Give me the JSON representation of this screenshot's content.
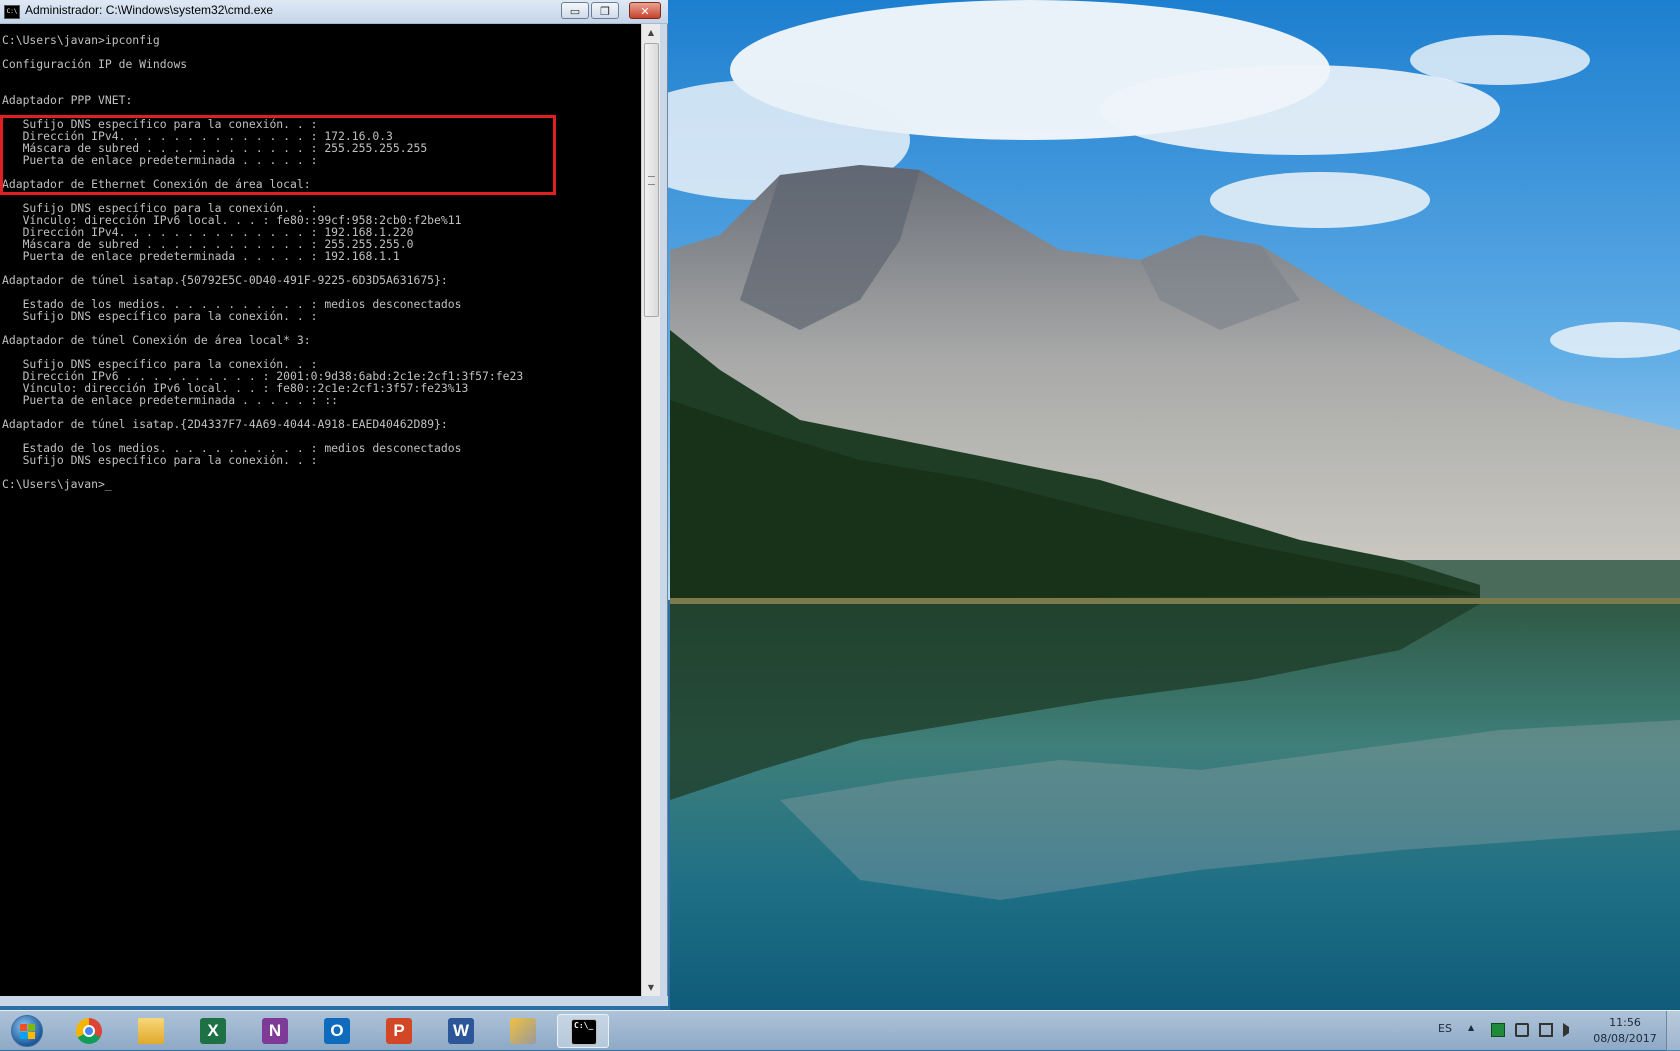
{
  "window": {
    "title": "Administrador: C:\\Windows\\system32\\cmd.exe",
    "title_icon_text": "C:\\",
    "minimize_glyph": "▭",
    "maximize_glyph": "❐",
    "close_glyph": "✕"
  },
  "console": {
    "lines": [
      "C:\\Users\\javan>ipconfig",
      "",
      "Configuración IP de Windows",
      "",
      "",
      "Adaptador PPP VNET:",
      "",
      "   Sufijo DNS específico para la conexión. . :",
      "   Dirección IPv4. . . . . . . . . . . . . . : 172.16.0.3",
      "   Máscara de subred . . . . . . . . . . . . : 255.255.255.255",
      "   Puerta de enlace predeterminada . . . . . :",
      "",
      "Adaptador de Ethernet Conexión de área local:",
      "",
      "   Sufijo DNS específico para la conexión. . :",
      "   Vínculo: dirección IPv6 local. . . : fe80::99cf:958:2cb0:f2be%11",
      "   Dirección IPv4. . . . . . . . . . . . . . : 192.168.1.220",
      "   Máscara de subred . . . . . . . . . . . . : 255.255.255.0",
      "   Puerta de enlace predeterminada . . . . . : 192.168.1.1",
      "",
      "Adaptador de túnel isatap.{50792E5C-0D40-491F-9225-6D3D5A631675}:",
      "",
      "   Estado de los medios. . . . . . . . . . . : medios desconectados",
      "   Sufijo DNS específico para la conexión. . :",
      "",
      "Adaptador de túnel Conexión de área local* 3:",
      "",
      "   Sufijo DNS específico para la conexión. . :",
      "   Dirección IPv6 . . . . . . . . . . : 2001:0:9d38:6abd:2c1e:2cf1:3f57:fe23",
      "   Vínculo: dirección IPv6 local. . . : fe80::2c1e:2cf1:3f57:fe23%13",
      "   Puerta de enlace predeterminada . . . . . : ::",
      "",
      "Adaptador de túnel isatap.{2D4337F7-4A69-4044-A918-EAED40462D89}:",
      "",
      "   Estado de los medios. . . . . . . . . . . : medios desconectados",
      "   Sufijo DNS específico para la conexión. . :",
      "",
      "C:\\Users\\javan>_"
    ]
  },
  "scrollbar": {
    "up_glyph": "▲",
    "down_glyph": "▼"
  },
  "taskbar": {
    "apps": [
      {
        "name": "chrome",
        "label": ""
      },
      {
        "name": "file-explorer",
        "label": ""
      },
      {
        "name": "excel",
        "label": "X"
      },
      {
        "name": "onenote",
        "label": "N"
      },
      {
        "name": "outlook",
        "label": "O"
      },
      {
        "name": "powerpoint",
        "label": "P"
      },
      {
        "name": "word",
        "label": "W"
      },
      {
        "name": "tools",
        "label": ""
      },
      {
        "name": "cmd",
        "label": "C:\\_"
      }
    ],
    "tray": {
      "language": "ES",
      "arrow": "▲",
      "time": "11:56",
      "date": "08/08/2017"
    }
  },
  "colors": {
    "console_bg": "#000000",
    "console_fg": "#c0c0c0",
    "highlight": "#e02020",
    "excel": "#1e7145",
    "onenote": "#7d3b97",
    "outlook": "#0f6cbd",
    "powerpoint": "#d24726",
    "word": "#2b579a"
  }
}
